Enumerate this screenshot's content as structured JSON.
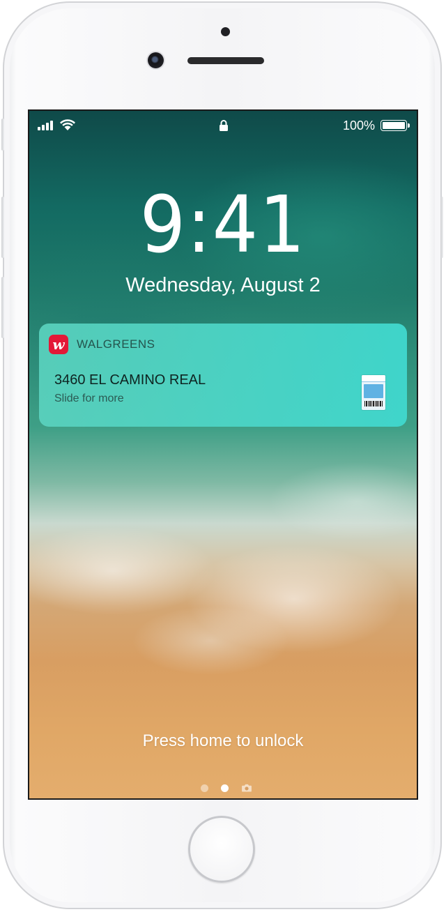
{
  "status_bar": {
    "battery_percent": "100%",
    "battery_level": 1.0,
    "signal_bars": 4,
    "icons": [
      "signal-icon",
      "wifi-icon",
      "lock-icon",
      "battery-icon"
    ]
  },
  "lock_screen": {
    "time": "9:41",
    "date": "Wednesday, August 2",
    "unlock_hint": "Press home to unlock"
  },
  "notification": {
    "app_name": "WALGREENS",
    "app_icon_letter": "w",
    "app_icon_color": "#e31837",
    "title": "3460 EL CAMINO REAL",
    "subtitle": "Slide for more",
    "attachment": "wallet-pass-thumbnail"
  },
  "page_indicator": {
    "pages": 3,
    "active_index": 1,
    "last_is_camera": true
  },
  "device": {
    "hardware": [
      "front-camera",
      "earpiece-speaker",
      "proximity-sensor",
      "home-button"
    ]
  }
}
